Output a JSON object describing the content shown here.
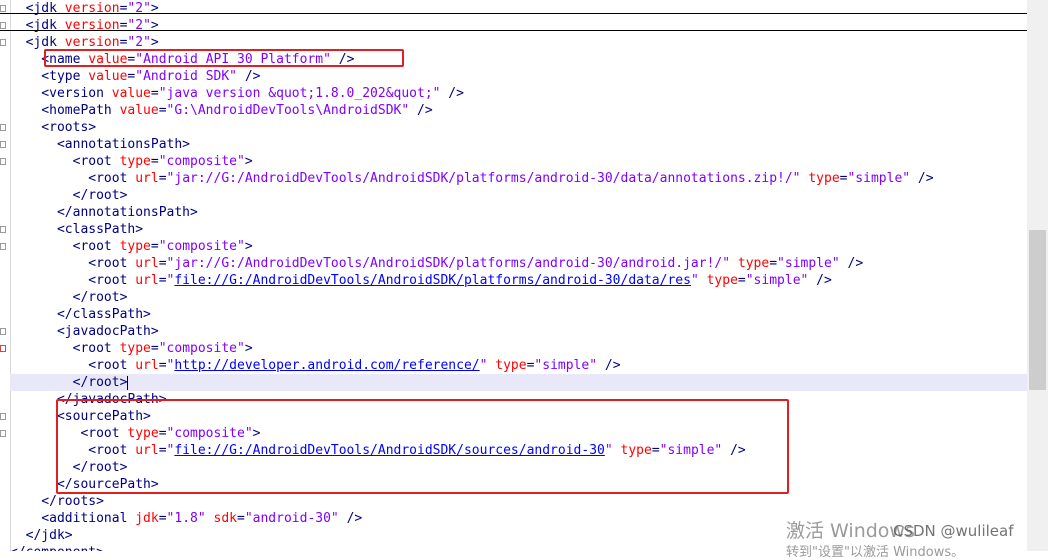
{
  "lines": [
    [
      {
        "c": "t",
        "s": "  <jdk "
      },
      {
        "c": "a",
        "s": "version"
      },
      {
        "c": "p",
        "s": "="
      },
      {
        "c": "v",
        "s": "\"2\""
      },
      {
        "c": "t",
        "s": ">"
      }
    ],
    [
      {
        "c": "t",
        "s": "  <jdk "
      },
      {
        "c": "a",
        "s": "version"
      },
      {
        "c": "p",
        "s": "="
      },
      {
        "c": "v",
        "s": "\"2\""
      },
      {
        "c": "t",
        "s": ">"
      }
    ],
    [
      {
        "c": "t",
        "s": "  <jdk "
      },
      {
        "c": "a",
        "s": "version"
      },
      {
        "c": "p",
        "s": "="
      },
      {
        "c": "v",
        "s": "\"2\""
      },
      {
        "c": "t",
        "s": ">"
      }
    ],
    [
      {
        "c": "t",
        "s": "    <name "
      },
      {
        "c": "a",
        "s": "value"
      },
      {
        "c": "p",
        "s": "="
      },
      {
        "c": "v",
        "s": "\"Android API 30 Platform\""
      },
      {
        "c": "t",
        "s": " />"
      }
    ],
    [
      {
        "c": "t",
        "s": "    <type "
      },
      {
        "c": "a",
        "s": "value"
      },
      {
        "c": "p",
        "s": "="
      },
      {
        "c": "v",
        "s": "\"Android SDK\""
      },
      {
        "c": "t",
        "s": " />"
      }
    ],
    [
      {
        "c": "t",
        "s": "    <version "
      },
      {
        "c": "a",
        "s": "value"
      },
      {
        "c": "p",
        "s": "="
      },
      {
        "c": "v",
        "s": "\"java version &quot;1.8.0_202&quot;\""
      },
      {
        "c": "t",
        "s": " />"
      }
    ],
    [
      {
        "c": "t",
        "s": "    <homePath "
      },
      {
        "c": "a",
        "s": "value"
      },
      {
        "c": "p",
        "s": "="
      },
      {
        "c": "v",
        "s": "\"G:\\AndroidDevTools\\AndroidSDK\""
      },
      {
        "c": "t",
        "s": " />"
      }
    ],
    [
      {
        "c": "t",
        "s": "    <roots>"
      }
    ],
    [
      {
        "c": "t",
        "s": "      <annotationsPath>"
      }
    ],
    [
      {
        "c": "t",
        "s": "        <root "
      },
      {
        "c": "a",
        "s": "type"
      },
      {
        "c": "p",
        "s": "="
      },
      {
        "c": "v",
        "s": "\"composite\""
      },
      {
        "c": "t",
        "s": ">"
      }
    ],
    [
      {
        "c": "t",
        "s": "          <root "
      },
      {
        "c": "a",
        "s": "url"
      },
      {
        "c": "p",
        "s": "="
      },
      {
        "c": "v",
        "s": "\"jar://G:/AndroidDevTools/AndroidSDK/platforms/android-30/data/annotations.zip!/\""
      },
      {
        "c": "t",
        "s": " "
      },
      {
        "c": "a",
        "s": "type"
      },
      {
        "c": "p",
        "s": "="
      },
      {
        "c": "v",
        "s": "\"simple\""
      },
      {
        "c": "t",
        "s": " />"
      }
    ],
    [
      {
        "c": "t",
        "s": "        </root>"
      }
    ],
    [
      {
        "c": "t",
        "s": "      </annotationsPath>"
      }
    ],
    [
      {
        "c": "t",
        "s": "      <classPath>"
      }
    ],
    [
      {
        "c": "t",
        "s": "        <root "
      },
      {
        "c": "a",
        "s": "type"
      },
      {
        "c": "p",
        "s": "="
      },
      {
        "c": "v",
        "s": "\"composite\""
      },
      {
        "c": "t",
        "s": ">"
      }
    ],
    [
      {
        "c": "t",
        "s": "          <root "
      },
      {
        "c": "a",
        "s": "url"
      },
      {
        "c": "p",
        "s": "="
      },
      {
        "c": "v",
        "s": "\"jar://G:/AndroidDevTools/AndroidSDK/platforms/android-30/android.jar!/\""
      },
      {
        "c": "t",
        "s": " "
      },
      {
        "c": "a",
        "s": "type"
      },
      {
        "c": "p",
        "s": "="
      },
      {
        "c": "v",
        "s": "\"simple\""
      },
      {
        "c": "t",
        "s": " />"
      }
    ],
    [
      {
        "c": "t",
        "s": "          <root "
      },
      {
        "c": "a",
        "s": "url"
      },
      {
        "c": "p",
        "s": "="
      },
      {
        "c": "v",
        "s": "\""
      },
      {
        "c": "u",
        "s": "file://G:/AndroidDevTools/AndroidSDK/platforms/android-30/data/res"
      },
      {
        "c": "v",
        "s": "\""
      },
      {
        "c": "t",
        "s": " "
      },
      {
        "c": "a",
        "s": "type"
      },
      {
        "c": "p",
        "s": "="
      },
      {
        "c": "v",
        "s": "\"simple\""
      },
      {
        "c": "t",
        "s": " />"
      }
    ],
    [
      {
        "c": "t",
        "s": "        </root>"
      }
    ],
    [
      {
        "c": "t",
        "s": "      </classPath>"
      }
    ],
    [
      {
        "c": "t",
        "s": "      <javadocPath>"
      }
    ],
    [
      {
        "c": "t",
        "s": "        <root "
      },
      {
        "c": "a",
        "s": "type"
      },
      {
        "c": "p",
        "s": "="
      },
      {
        "c": "v",
        "s": "\"composite\""
      },
      {
        "c": "t",
        "s": ">"
      }
    ],
    [
      {
        "c": "t",
        "s": "          <root "
      },
      {
        "c": "a",
        "s": "url"
      },
      {
        "c": "p",
        "s": "="
      },
      {
        "c": "v",
        "s": "\""
      },
      {
        "c": "u",
        "s": "http://developer.android.com/reference/"
      },
      {
        "c": "v",
        "s": "\""
      },
      {
        "c": "t",
        "s": " "
      },
      {
        "c": "a",
        "s": "type"
      },
      {
        "c": "p",
        "s": "="
      },
      {
        "c": "v",
        "s": "\"simple\""
      },
      {
        "c": "t",
        "s": " />"
      }
    ],
    [
      {
        "c": "t",
        "s": "        </root>"
      }
    ],
    [
      {
        "c": "t",
        "s": "      </javadocPath>"
      }
    ],
    [
      {
        "c": "t",
        "s": "      <sourcePath>"
      }
    ],
    [
      {
        "c": "t",
        "s": "         <root "
      },
      {
        "c": "a",
        "s": "type"
      },
      {
        "c": "p",
        "s": "="
      },
      {
        "c": "v",
        "s": "\"composite\""
      },
      {
        "c": "t",
        "s": ">"
      }
    ],
    [
      {
        "c": "t",
        "s": "          <root "
      },
      {
        "c": "a",
        "s": "url"
      },
      {
        "c": "p",
        "s": "="
      },
      {
        "c": "v",
        "s": "\""
      },
      {
        "c": "u",
        "s": "file://G:/AndroidDevTools/AndroidSDK/sources/android-30"
      },
      {
        "c": "v",
        "s": "\""
      },
      {
        "c": "t",
        "s": " "
      },
      {
        "c": "a",
        "s": "type"
      },
      {
        "c": "p",
        "s": "="
      },
      {
        "c": "v",
        "s": "\"simple\""
      },
      {
        "c": "t",
        "s": " />"
      }
    ],
    [
      {
        "c": "t",
        "s": "        </root>"
      }
    ],
    [
      {
        "c": "t",
        "s": "      </sourcePath>"
      }
    ],
    [
      {
        "c": "t",
        "s": "    </roots>"
      }
    ],
    [
      {
        "c": "t",
        "s": "    <additional "
      },
      {
        "c": "a",
        "s": "jdk"
      },
      {
        "c": "p",
        "s": "="
      },
      {
        "c": "v",
        "s": "\"1.8\""
      },
      {
        "c": "t",
        "s": " "
      },
      {
        "c": "a",
        "s": "sdk"
      },
      {
        "c": "p",
        "s": "="
      },
      {
        "c": "v",
        "s": "\"android-30\""
      },
      {
        "c": "t",
        "s": " />"
      }
    ],
    [
      {
        "c": "t",
        "s": "  </jdk>"
      }
    ],
    [
      {
        "c": "t",
        "s": "</component>"
      }
    ]
  ],
  "current_line": 22,
  "watermark": {
    "activate_title": "激活 Windows",
    "activate_sub": "转到\"设置\"以激活 Windows。",
    "csdn": "CSDN @wulileaf"
  },
  "colors": {
    "tag": "#000080",
    "attribute": "#ff0000",
    "value": "#8000ff",
    "url": "#0000ff",
    "highlight_box": "#e02020",
    "current_line_bg": "#e8e8f8"
  }
}
